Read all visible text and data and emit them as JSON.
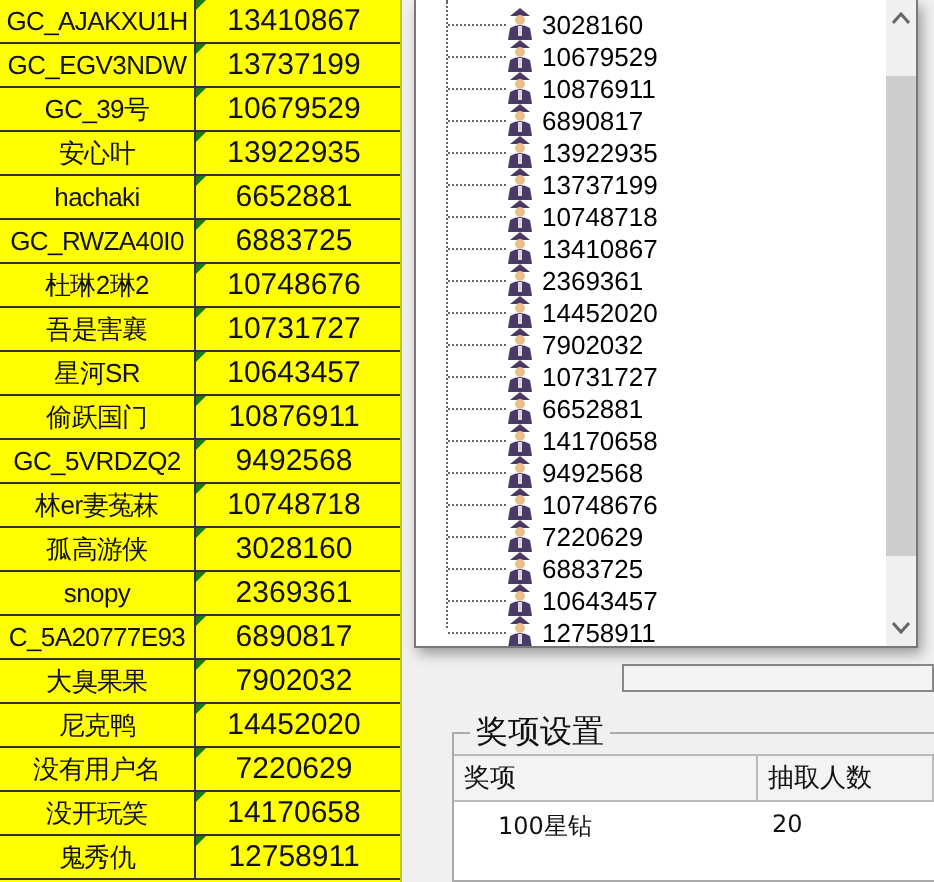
{
  "sheet": {
    "rows": [
      {
        "name": "GC_AJAKXU1H",
        "id": "13410867"
      },
      {
        "name": "GC_EGV3NDW",
        "id": "13737199"
      },
      {
        "name": "GC_39号",
        "id": "10679529"
      },
      {
        "name": "安心叶",
        "id": "13922935"
      },
      {
        "name": "hachaki",
        "id": "6652881"
      },
      {
        "name": "GC_RWZA40I0",
        "id": "6883725"
      },
      {
        "name": "杜琳2琳2",
        "id": "10748676"
      },
      {
        "name": "吾是害襄",
        "id": "10731727"
      },
      {
        "name": "星河SR",
        "id": "10643457"
      },
      {
        "name": "偷跃国门",
        "id": "10876911"
      },
      {
        "name": "GC_5VRDZQ2",
        "id": "9492568"
      },
      {
        "name": "林er妻菟菻",
        "id": "10748718"
      },
      {
        "name": "孤高游侠",
        "id": "3028160"
      },
      {
        "name": "snopy",
        "id": "2369361"
      },
      {
        "name": "C_5A20777E93",
        "id": "6890817"
      },
      {
        "name": "大臭果果",
        "id": "7902032"
      },
      {
        "name": "尼克鸭",
        "id": "14452020"
      },
      {
        "name": "没有用户名",
        "id": "7220629"
      },
      {
        "name": "没开玩笑",
        "id": "14170658"
      },
      {
        "name": "鬼秀仇",
        "id": "12758911"
      }
    ]
  },
  "tree": {
    "items": [
      "3028160",
      "10679529",
      "10876911",
      "6890817",
      "13922935",
      "13737199",
      "10748718",
      "13410867",
      "2369361",
      "14452020",
      "7902032",
      "10731727",
      "6652881",
      "14170658",
      "9492568",
      "10748676",
      "7220629",
      "6883725",
      "10643457",
      "12758911"
    ]
  },
  "prize_group": {
    "title": "奖项设置",
    "columns": [
      "奖项",
      "抽取人数"
    ],
    "rows": [
      {
        "prize": "100星钻",
        "count": "20"
      }
    ]
  }
}
